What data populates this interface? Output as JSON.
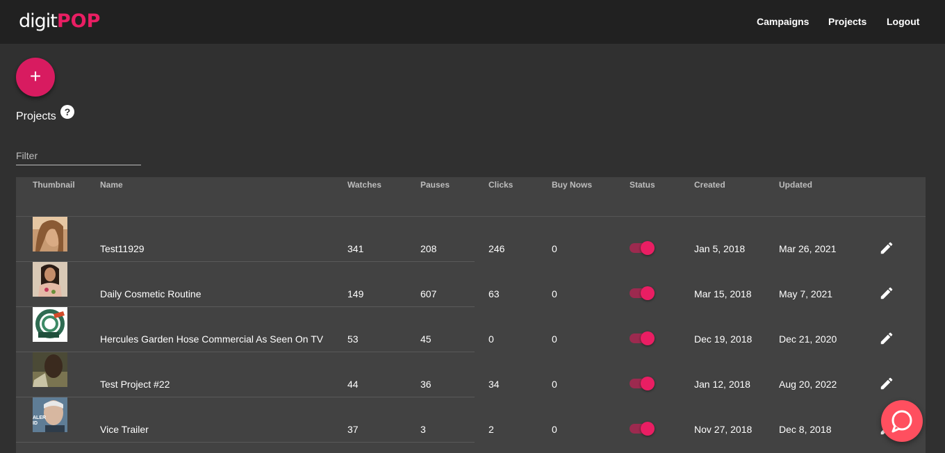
{
  "header": {
    "logo_text": "digit",
    "logo_accent": "POP",
    "nav": [
      "Campaigns",
      "Projects",
      "Logout"
    ]
  },
  "fab": {
    "label": "+",
    "icon": "plus-icon"
  },
  "page": {
    "title": "Projects",
    "help": "?"
  },
  "filter": {
    "placeholder": "Filter",
    "value": ""
  },
  "table": {
    "columns": [
      "Thumbnail",
      "Name",
      "Watches",
      "Pauses",
      "Clicks",
      "Buy Nows",
      "Status",
      "Created",
      "Updated"
    ],
    "rows": [
      {
        "name": "Test11929",
        "watches": "341",
        "pauses": "208",
        "clicks": "246",
        "buy_nows": "0",
        "status": true,
        "created": "Jan 5, 2018",
        "updated": "Mar 26, 2021"
      },
      {
        "name": "Daily Cosmetic Routine",
        "watches": "149",
        "pauses": "607",
        "clicks": "63",
        "buy_nows": "0",
        "status": true,
        "created": "Mar 15, 2018",
        "updated": "May 7, 2021"
      },
      {
        "name": "Hercules Garden Hose Commercial As Seen On TV",
        "watches": "53",
        "pauses": "45",
        "clicks": "0",
        "buy_nows": "0",
        "status": true,
        "created": "Dec 19, 2018",
        "updated": "Dec 21, 2020"
      },
      {
        "name": "Test Project #22",
        "watches": "44",
        "pauses": "36",
        "clicks": "34",
        "buy_nows": "0",
        "status": true,
        "created": "Jan 12, 2018",
        "updated": "Aug 20, 2022"
      },
      {
        "name": "Vice Trailer",
        "watches": "37",
        "pauses": "3",
        "clicks": "2",
        "buy_nows": "0",
        "status": true,
        "created": "Nov 27, 2018",
        "updated": "Dec 8, 2018"
      }
    ]
  },
  "thumb_texts": {
    "row5": "ALER\nID"
  },
  "colors": {
    "accent": "#e91e63",
    "header_bg": "#212121",
    "page_bg": "#303030",
    "table_bg": "#424242",
    "chat": "#ff4f5f"
  },
  "icons": {
    "edit": "pencil-icon",
    "chat": "chat-icon",
    "help": "help-icon"
  }
}
